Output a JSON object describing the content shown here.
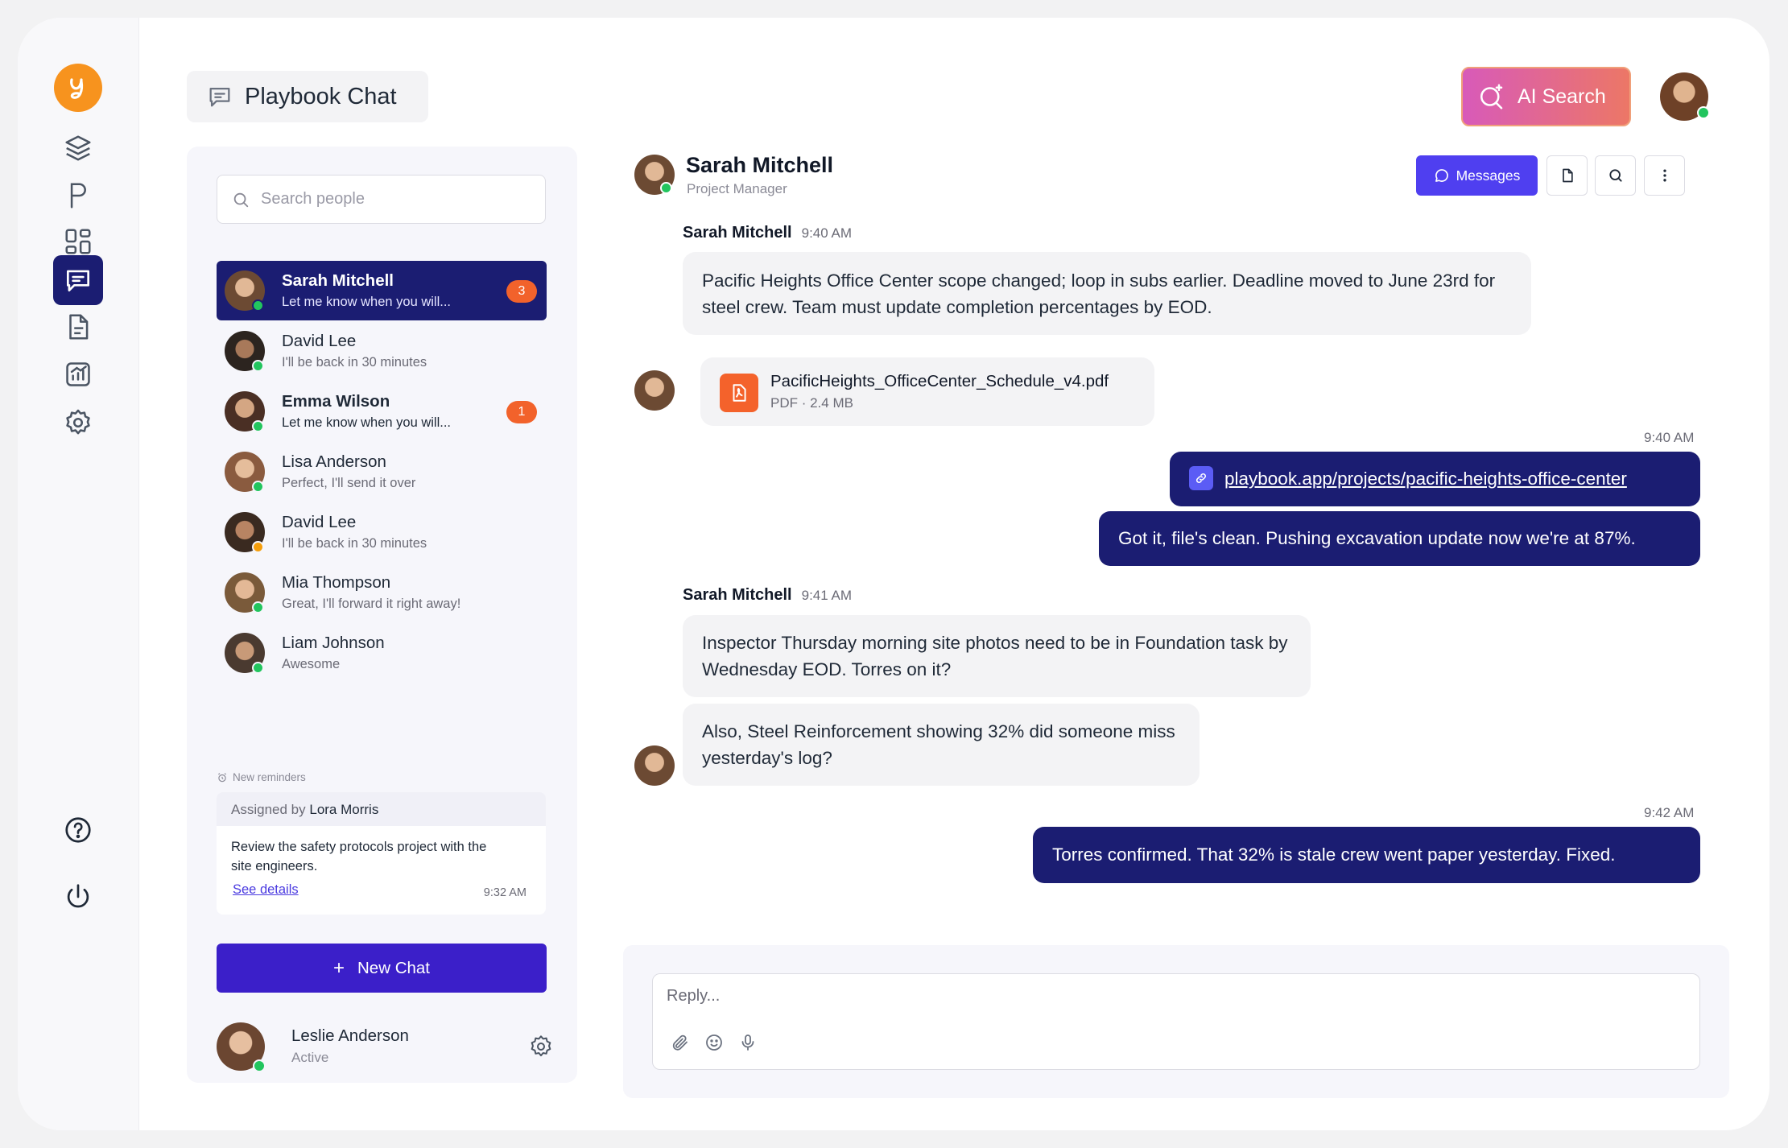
{
  "app": {
    "title": "Playbook Chat",
    "ai_search": "AI Search"
  },
  "nav": [
    "logo-icon",
    "layers-icon",
    "projects-icon",
    "dashboard-icon",
    "chat-icon",
    "document-icon",
    "reports-icon",
    "settings-icon",
    "help-icon",
    "power-icon"
  ],
  "people": {
    "search_placeholder": "Search people",
    "contacts": [
      {
        "name": "Sarah Mitchell",
        "message": "Let me know when you will...",
        "badge": "3",
        "status": "online"
      },
      {
        "name": "David Lee",
        "message": "I'll be back in 30 minutes",
        "badge": "",
        "status": "online"
      },
      {
        "name": "Emma Wilson",
        "message": "Let me know when you will...",
        "badge": "1",
        "status": "online"
      },
      {
        "name": "Lisa Anderson",
        "message": "Perfect, I'll send it over",
        "badge": "",
        "status": "online"
      },
      {
        "name": "David Lee",
        "message": "I'll be back in 30 minutes",
        "badge": "",
        "status": "away"
      },
      {
        "name": "Mia Thompson",
        "message": "Great, I'll forward it right away!",
        "badge": "",
        "status": "online"
      },
      {
        "name": "Liam Johnson",
        "message": "Awesome",
        "badge": "",
        "status": "online"
      }
    ],
    "reminders": {
      "heading": "New reminders",
      "assigned_prefix": "Assigned by",
      "assigned_by": "Lora Morris",
      "text": "Review the safety protocols project with the site engineers.",
      "link": "See details",
      "time": "9:32 AM"
    },
    "new_chat": "New Chat",
    "me": {
      "name": "Leslie Anderson",
      "status": "Active"
    }
  },
  "chat": {
    "name": "Sarah Mitchell",
    "role": "Project Manager",
    "messages_button": "Messages",
    "groups": [
      {
        "sender": "Sarah Mitchell",
        "time": "9:40 AM"
      },
      {
        "sender": "Sarah Mitchell",
        "time": "9:41 AM"
      }
    ],
    "msg1": "Pacific Heights Office Center scope changed; loop in subs earlier. Deadline moved to June 23rd for steel crew. Team must update completion percentages by EOD.",
    "file": {
      "name": "PacificHeights_OfficeCenter_Schedule_v4.pdf",
      "meta": "PDF · 2.4 MB"
    },
    "out_time1": "9:40 AM",
    "link": "playbook.app/projects/pacific-heights-office-center",
    "out1": "Got it, file's clean. Pushing excavation update now we're at 87%.",
    "msg2": "Inspector Thursday morning site photos need to be in Foundation task by Wednesday EOD. Torres on it?",
    "msg3": "Also, Steel Reinforcement showing 32% did someone miss yesterday's log?",
    "out_time2": "9:42 AM",
    "out2": "Torres confirmed. That 32% is stale crew went paper yesterday. Fixed.",
    "reply_placeholder": "Reply..."
  },
  "colors": {
    "navy": "#1b1d72",
    "indigo": "#3b1fc9",
    "accent_orange": "#f2622b",
    "online": "#22c55e",
    "away": "#f59e0b"
  }
}
